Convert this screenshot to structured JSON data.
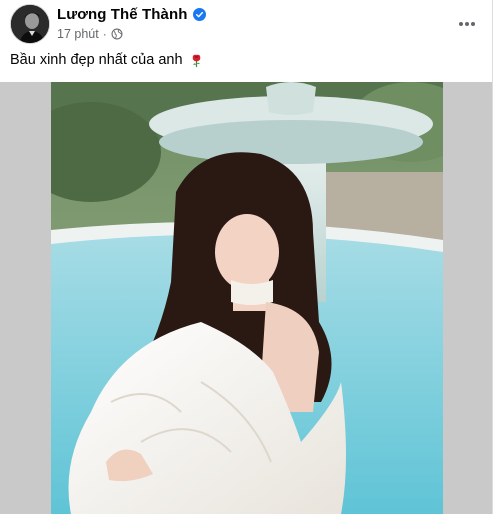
{
  "post": {
    "author": {
      "name": "Lương Thế Thành",
      "verified": true,
      "avatar_icon": "avatar-portrait"
    },
    "timestamp": "17 phút",
    "separator": "·",
    "audience_icon": "globe-icon",
    "more_icon": "more-horizontal-icon",
    "caption": "Bầu xinh đẹp nhất của anh",
    "caption_emoji_icon": "rose-icon"
  },
  "media": {
    "type": "photo",
    "backdrop_color": "#c9c9ca"
  },
  "colors": {
    "primary_text": "#050505",
    "secondary_text": "#65676b",
    "verified_blue": "#1877f2"
  }
}
